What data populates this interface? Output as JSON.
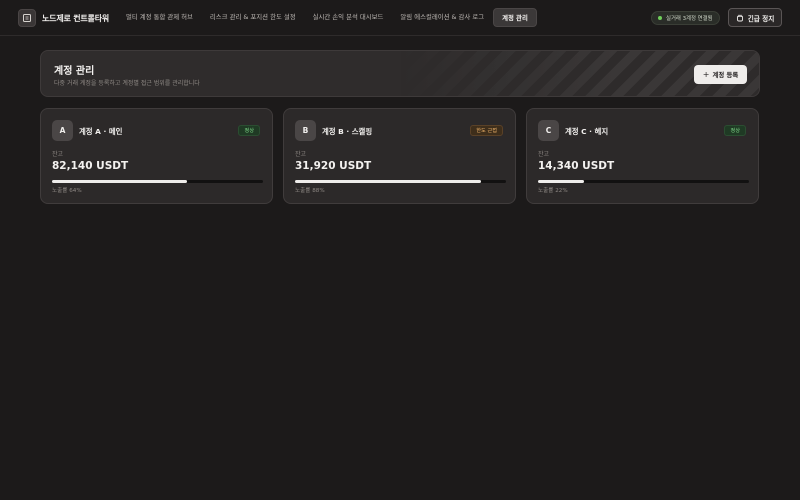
{
  "app": {
    "name": "노드제로 컨트롤타워"
  },
  "nav": {
    "items": [
      {
        "label": "멀티 계정 통합 관제 허브",
        "active": false
      },
      {
        "label": "리스크 관리 & 포지션 한도 설정",
        "active": false
      },
      {
        "label": "실시간 손익 분석 대시보드",
        "active": false
      },
      {
        "label": "알림 에스컬레이션 & 감사 로그",
        "active": false
      },
      {
        "label": "계정 관리",
        "active": true
      }
    ]
  },
  "header": {
    "connection_badge": "실거래 3계정 연결됨",
    "emergency_stop_label": "긴급 정지",
    "colors": {
      "connected": "#6fcf5a"
    }
  },
  "hero": {
    "title": "계정 관리",
    "subtitle": "다중 거래 계정을 등록하고 계정별 접근 범위를 관리합니다",
    "add_button_label": "계정 등록"
  },
  "accounts": [
    {
      "avatar": "A",
      "name": "계정 A · 메인",
      "status": "정상",
      "status_kind": "ok",
      "balance_label": "잔고",
      "balance": "82,140 USDT",
      "exposure_label": "노출률 64%",
      "exposure": 0.64
    },
    {
      "avatar": "B",
      "name": "계정 B · 스캘핑",
      "status": "한도 근접",
      "status_kind": "warn",
      "balance_label": "잔고",
      "balance": "31,920 USDT",
      "exposure_label": "노출률 88%",
      "exposure": 0.88
    },
    {
      "avatar": "C",
      "name": "계정 C · 헤지",
      "status": "정상",
      "status_kind": "ok",
      "balance_label": "잔고",
      "balance": "14,340 USDT",
      "exposure_label": "노출률 22%",
      "exposure": 0.22
    }
  ]
}
